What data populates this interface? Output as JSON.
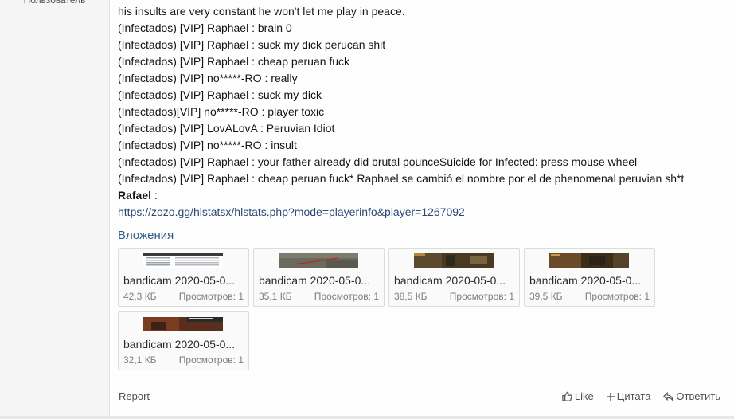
{
  "user": {
    "role": "Пользователь"
  },
  "post": {
    "lines": [
      "his insults are very constant he won't let me play in peace.",
      "(Infectados) [VIP] Raphael : brain 0",
      "(Infectados) [VIP] Raphael : suck my dick perucan shit",
      "(Infectados) [VIP] Raphael : cheap peruan fuck",
      "(Infectados) [VIP] no*****-RO : really",
      "(Infectados) [VIP] Raphael : suck my dick",
      "(Infectados)[VIP] no*****-RO : player toxic",
      "(Infectados) [VIP] LovALovA : Peruvian Idiot",
      "(Infectados) [VIP] no*****-RO : insult",
      "(Infectados) [VIP] Raphael : your father already did brutal pounceSuicide for Infected: press mouse wheel",
      "(Infectados) [VIP] Raphael : cheap peruan fuck* Raphael se cambió el nombre por el de phenomenal peruvian sh*t"
    ],
    "rafael_label": "Rafael",
    "rafael_sep": " :",
    "link": "https://zozo.gg/hlstatsx/hlstats.php?mode=playerinfo&player=1267092"
  },
  "attachments": {
    "title": "Вложения",
    "items": [
      {
        "name": "bandicam 2020-05-0...",
        "size": "42,3 КБ",
        "views": "Просмотров: 1"
      },
      {
        "name": "bandicam 2020-05-0...",
        "size": "35,1 КБ",
        "views": "Просмотров: 1"
      },
      {
        "name": "bandicam 2020-05-0...",
        "size": "38,5 КБ",
        "views": "Просмотров: 1"
      },
      {
        "name": "bandicam 2020-05-0...",
        "size": "39,5 КБ",
        "views": "Просмотров: 1"
      },
      {
        "name": "bandicam 2020-05-0...",
        "size": "32,1 КБ",
        "views": "Просмотров: 1"
      }
    ]
  },
  "footer": {
    "report": "Report",
    "like": "Like",
    "quote": "Цитата",
    "reply": "Ответить"
  },
  "icons": {
    "like": "thumbs-up-icon",
    "quote": "plus-icon",
    "reply": "reply-arrow-icon"
  }
}
